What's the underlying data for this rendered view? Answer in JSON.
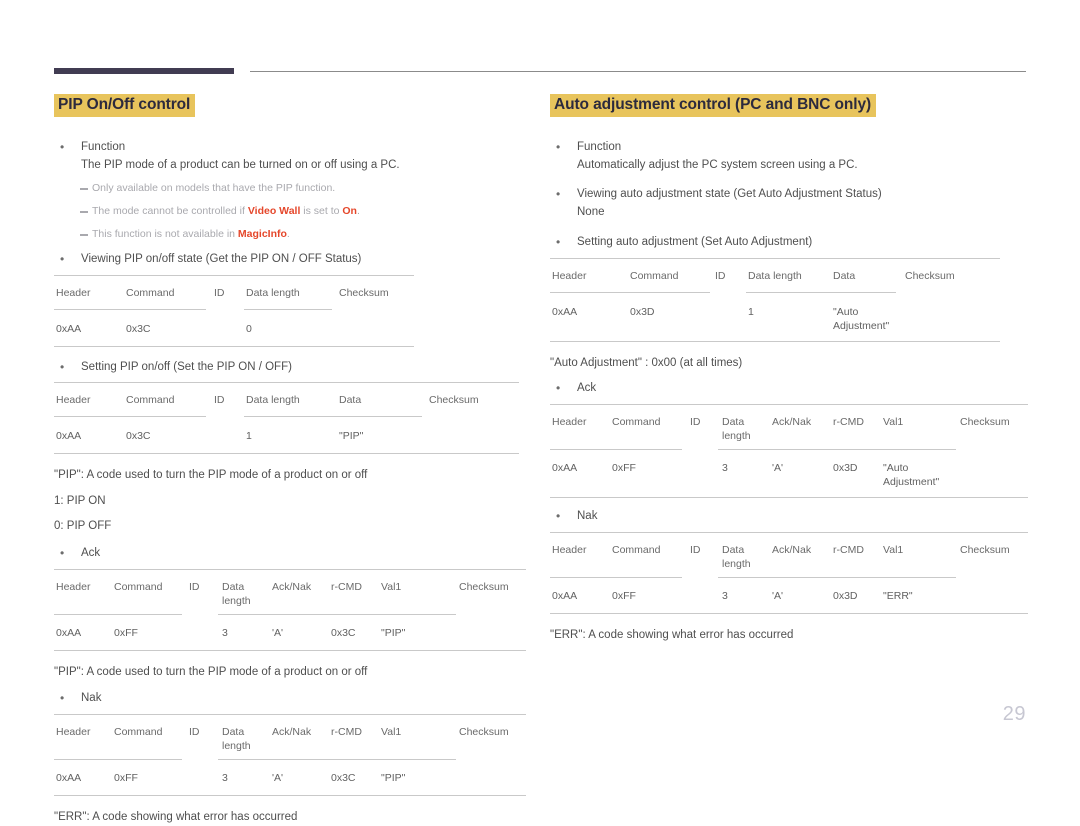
{
  "page_number": "29",
  "colors": {
    "heading_highlight": "#e8c45c",
    "heading_text": "#2c2a3d",
    "accent_red": "#e5472b",
    "rule_dark": "#413c52",
    "rule_gray": "#8b8b8b",
    "table_line": "#c9c9c9",
    "page_number": "#c7c7d2"
  },
  "left": {
    "heading": "PIP On/Off control",
    "function_label": "Function",
    "function_text": "The PIP mode of a product can be turned on or off using a PC.",
    "notes": [
      {
        "pre": "Only available on models that have the PIP function.",
        "bold1": "",
        "mid": "",
        "bold2": "",
        "post": ""
      },
      {
        "pre": "The mode cannot be controlled if ",
        "bold1": "Video Wall",
        "mid": " is set to ",
        "bold2": "On",
        "post": "."
      },
      {
        "pre": "This function is not available in ",
        "bold1": "MagicInfo",
        "mid": ".",
        "bold2": "",
        "post": ""
      }
    ],
    "get_label": "Viewing PIP on/off state (Get the PIP ON / OFF Status)",
    "get_table": {
      "headers": [
        "Header",
        "Command",
        "ID",
        "Data length",
        "Checksum"
      ],
      "row": [
        "0xAA",
        "0x3C",
        "",
        "0",
        ""
      ]
    },
    "set_label": "Setting PIP on/off (Set the PIP ON / OFF)",
    "set_table": {
      "headers": [
        "Header",
        "Command",
        "ID",
        "Data length",
        "Data",
        "Checksum"
      ],
      "row": [
        "0xAA",
        "0x3C",
        "",
        "1",
        "\"PIP\"",
        ""
      ]
    },
    "pip_desc": "\"PIP\": A code used to turn the PIP mode of a product on or off",
    "pip_on": "1: PIP ON",
    "pip_off": "0: PIP OFF",
    "ack_label": "Ack",
    "ack_table": {
      "headers": [
        "Header",
        "Command",
        "ID",
        "Data\nlength",
        "Ack/Nak",
        "r-CMD",
        "Val1",
        "Checksum"
      ],
      "row": [
        "0xAA",
        "0xFF",
        "",
        "3",
        "'A'",
        "0x3C",
        "\"PIP\"",
        ""
      ]
    },
    "pip_desc2": "\"PIP\": A code used to turn the PIP mode of a product on or off",
    "nak_label": "Nak",
    "nak_table": {
      "headers": [
        "Header",
        "Command",
        "ID",
        "Data\nlength",
        "Ack/Nak",
        "r-CMD",
        "Val1",
        "Checksum"
      ],
      "row": [
        "0xAA",
        "0xFF",
        "",
        "3",
        "'A'",
        "0x3C",
        "\"PIP\"",
        ""
      ]
    },
    "err_desc": "\"ERR\": A code showing what error has occurred"
  },
  "right": {
    "heading": "Auto adjustment control (PC and BNC only)",
    "function_label": "Function",
    "function_text": "Automatically adjust the PC system screen using a PC.",
    "get_label": "Viewing auto adjustment state (Get Auto Adjustment Status)",
    "get_value": "None",
    "set_label": "Setting auto adjustment (Set Auto Adjustment)",
    "set_table": {
      "headers": [
        "Header",
        "Command",
        "ID",
        "Data length",
        "Data",
        "Checksum"
      ],
      "row": [
        "0xAA",
        "0x3D",
        "",
        "1",
        "\"Auto\nAdjustment\"",
        ""
      ]
    },
    "auto_desc": "\"Auto Adjustment\" : 0x00 (at all times)",
    "ack_label": "Ack",
    "ack_table": {
      "headers": [
        "Header",
        "Command",
        "ID",
        "Data\nlength",
        "Ack/Nak",
        "r-CMD",
        "Val1",
        "Checksum"
      ],
      "row": [
        "0xAA",
        "0xFF",
        "",
        "3",
        "'A'",
        "0x3D",
        "\"Auto\nAdjustment\"",
        ""
      ]
    },
    "nak_label": "Nak",
    "nak_table": {
      "headers": [
        "Header",
        "Command",
        "ID",
        "Data\nlength",
        "Ack/Nak",
        "r-CMD",
        "Val1",
        "Checksum"
      ],
      "row": [
        "0xAA",
        "0xFF",
        "",
        "3",
        "'A'",
        "0x3D",
        "\"ERR\"",
        ""
      ]
    },
    "err_desc": "\"ERR\": A code showing what error has occurred"
  }
}
